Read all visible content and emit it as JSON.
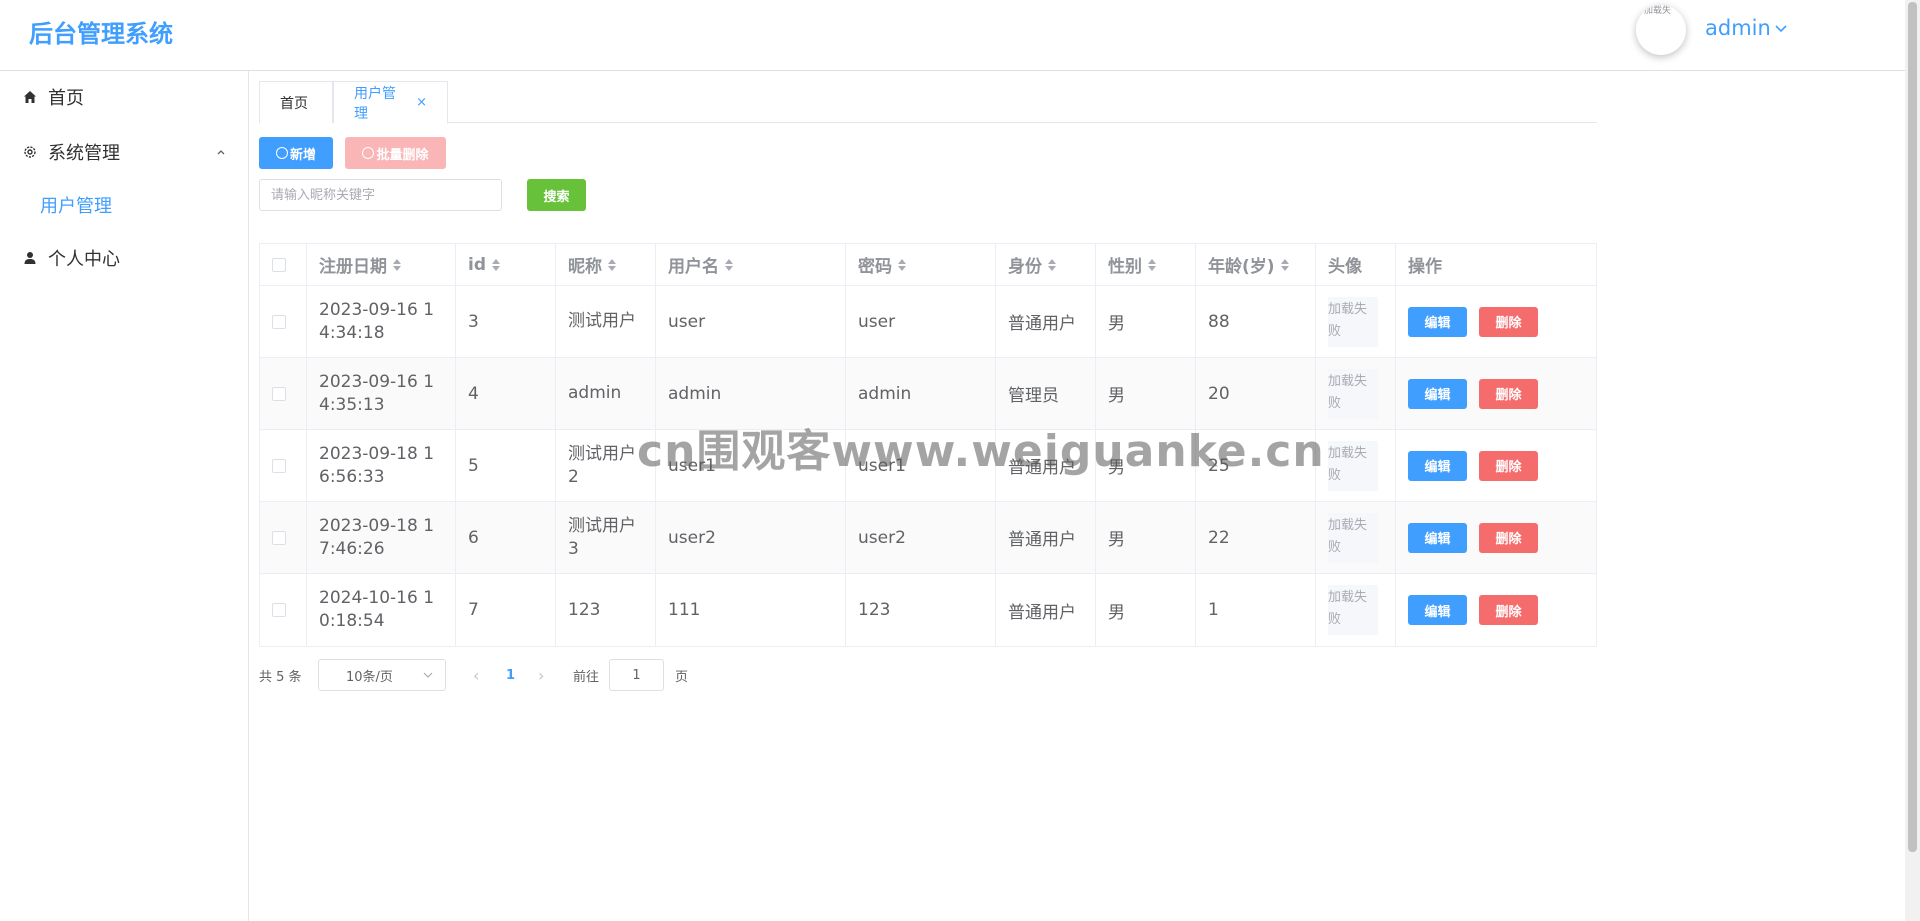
{
  "app": {
    "title": "后台管理系统"
  },
  "user": {
    "name": "admin",
    "avatar_alt": "加载失"
  },
  "sidebar": {
    "items": [
      {
        "label": "首页",
        "icon": "home-icon"
      },
      {
        "label": "系统管理",
        "icon": "gear-icon"
      },
      {
        "label": "用户管理"
      },
      {
        "label": "个人中心",
        "icon": "user-icon"
      }
    ]
  },
  "tabs": [
    {
      "label": "首页"
    },
    {
      "label": "用户管理",
      "close": "×"
    }
  ],
  "toolbar": {
    "add_label": "新增",
    "batch_delete_label": "批量删除",
    "search_placeholder": "请输入昵称关键字",
    "search_label": "搜索"
  },
  "table": {
    "columns": [
      "注册日期",
      "id",
      "昵称",
      "用户名",
      "密码",
      "身份",
      "性别",
      "年龄(岁)",
      "头像",
      "操作"
    ],
    "rows": [
      {
        "date": "2023-09-16 14:34:18",
        "id": "3",
        "nickname": "测试用户",
        "username": "user",
        "password": "user",
        "role": "普通用户",
        "gender": "男",
        "age": "88",
        "avatar": "加载失败"
      },
      {
        "date": "2023-09-16 14:35:13",
        "id": "4",
        "nickname": "admin",
        "username": "admin",
        "password": "admin",
        "role": "管理员",
        "gender": "男",
        "age": "20",
        "avatar": "加载失败"
      },
      {
        "date": "2023-09-18 16:56:33",
        "id": "5",
        "nickname": "测试用户2",
        "username": "user1",
        "password": "user1",
        "role": "普通用户",
        "gender": "男",
        "age": "25",
        "avatar": "加载失败"
      },
      {
        "date": "2023-09-18 17:46:26",
        "id": "6",
        "nickname": "测试用户3",
        "username": "user2",
        "password": "user2",
        "role": "普通用户",
        "gender": "男",
        "age": "22",
        "avatar": "加载失败"
      },
      {
        "date": "2024-10-16 10:18:54",
        "id": "7",
        "nickname": "123",
        "username": "111",
        "password": "123",
        "role": "普通用户",
        "gender": "男",
        "age": "1",
        "avatar": "加载失败"
      }
    ],
    "edit_label": "编辑",
    "delete_label": "删除"
  },
  "pagination": {
    "total": "共 5 条",
    "page_size": "10条/页",
    "prev": "‹",
    "current": "1",
    "next": "›",
    "goto_label": "前往",
    "goto_value": "1",
    "goto_unit": "页"
  },
  "watermark": "cn围观客www.weiguanke.cn",
  "colors": {
    "primary": "#409eff",
    "danger": "#f56c6c",
    "success": "#67c23a",
    "danger_light": "#fab6b6"
  }
}
